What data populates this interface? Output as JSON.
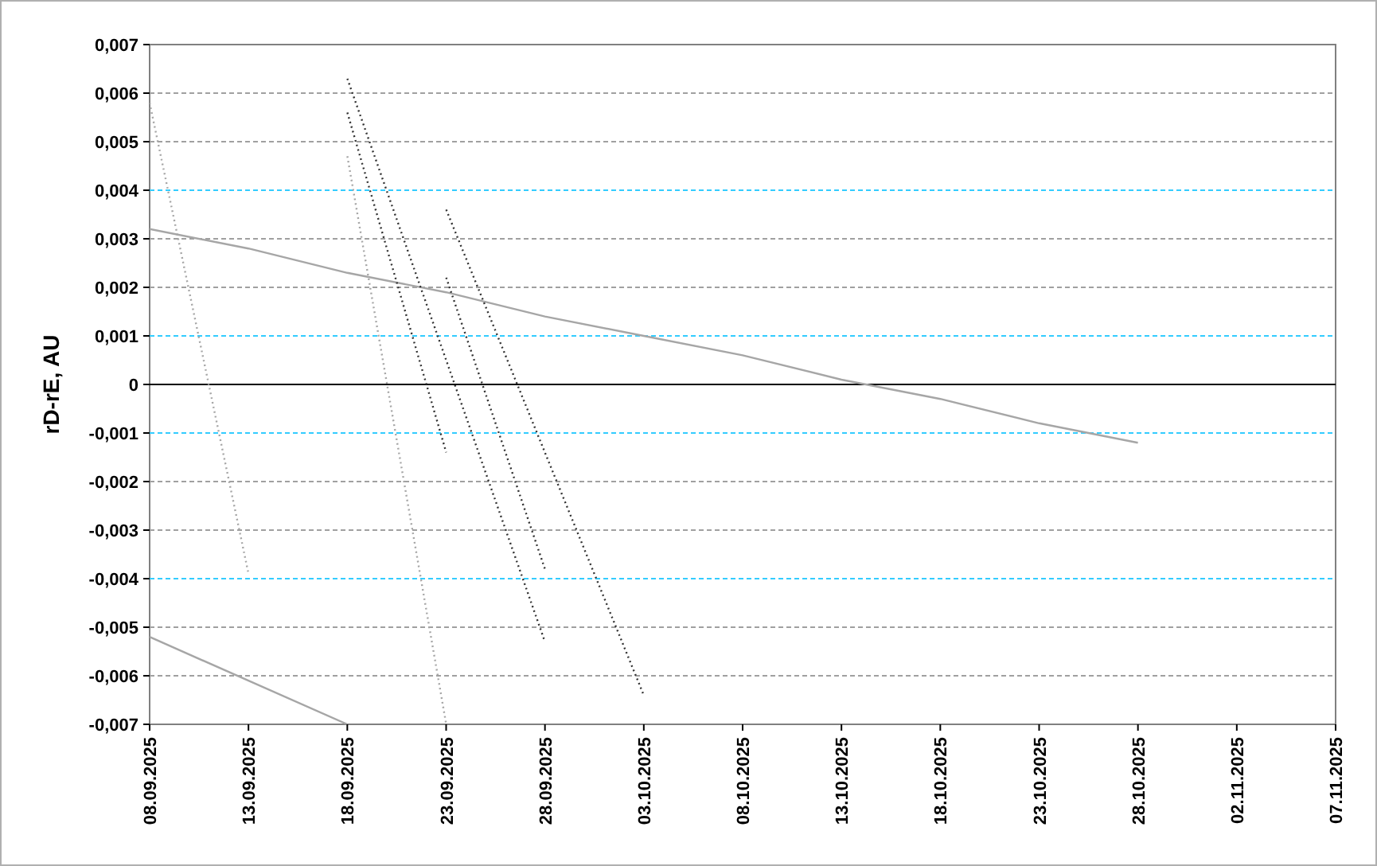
{
  "chart": {
    "chart_data": {
      "type": "line",
      "ylabel": "rD-rE, AU",
      "grid": true,
      "x": [
        "08.09.2025",
        "13.09.2025",
        "18.09.2025",
        "23.09.2025",
        "28.09.2025",
        "03.10.2025",
        "08.10.2025",
        "13.10.2025",
        "18.10.2025",
        "23.10.2025",
        "28.10.2025",
        "02.11.2025",
        "07.11.2025"
      ],
      "ylim": [
        -0.007,
        0.007
      ],
      "yticks": [
        {
          "value": 0.007,
          "label": "0,007"
        },
        {
          "value": 0.006,
          "label": "0,006"
        },
        {
          "value": 0.005,
          "label": "0,005"
        },
        {
          "value": 0.004,
          "label": "0,004"
        },
        {
          "value": 0.003,
          "label": "0,003"
        },
        {
          "value": 0.002,
          "label": "0,002"
        },
        {
          "value": 0.001,
          "label": "0,001"
        },
        {
          "value": 0,
          "label": "0"
        },
        {
          "value": -0.001,
          "label": "-0,001"
        },
        {
          "value": -0.002,
          "label": "-0,002"
        },
        {
          "value": -0.003,
          "label": "-0,003"
        },
        {
          "value": -0.004,
          "label": "-0,004"
        },
        {
          "value": -0.005,
          "label": "-0,005"
        },
        {
          "value": -0.006,
          "label": "-0,006"
        },
        {
          "value": -0.007,
          "label": "-0,007"
        }
      ],
      "series": [
        {
          "color": "#a6a6a6",
          "line_style": "solid",
          "values": [
            0.0032,
            0.0028,
            0.0023,
            0.0019,
            0.0014,
            0.001,
            0.0006,
            0.0001,
            -0.0003,
            -0.0008,
            -0.0012,
            null,
            null
          ]
        },
        {
          "color": "#a6a6a6",
          "line_style": "solid",
          "values": [
            -0.0052,
            -0.0061,
            -0.007,
            null,
            null,
            null,
            null,
            null,
            null,
            null,
            null,
            null,
            null
          ]
        },
        {
          "color": "#a6a6a6",
          "line_style": "dotted",
          "values": [
            0.0058,
            -0.0039,
            null,
            null,
            null,
            null,
            null,
            null,
            null,
            null,
            null,
            null,
            null
          ]
        },
        {
          "color": "#a6a6a6",
          "line_style": "dotted",
          "values": [
            null,
            null,
            0.0047,
            -0.007,
            null,
            null,
            null,
            null,
            null,
            null,
            null,
            null,
            null
          ]
        },
        {
          "color": "#333333",
          "line_style": "dotted",
          "values": [
            null,
            null,
            0.0056,
            -0.0014,
            null,
            null,
            null,
            null,
            null,
            null,
            null,
            null,
            null
          ]
        },
        {
          "color": "#333333",
          "line_style": "dotted",
          "values": [
            null,
            null,
            0.0063,
            0.0005,
            -0.0053,
            null,
            null,
            null,
            null,
            null,
            null,
            null,
            null
          ]
        },
        {
          "color": "#333333",
          "line_style": "dotted",
          "values": [
            null,
            null,
            null,
            0.0022,
            -0.0038,
            null,
            null,
            null,
            null,
            null,
            null,
            null,
            null
          ]
        },
        {
          "color": "#333333",
          "line_style": "dotted",
          "values": [
            null,
            null,
            null,
            0.0036,
            -0.0014,
            -0.0064,
            null,
            null,
            null,
            null,
            null,
            null,
            null
          ]
        }
      ]
    }
  }
}
